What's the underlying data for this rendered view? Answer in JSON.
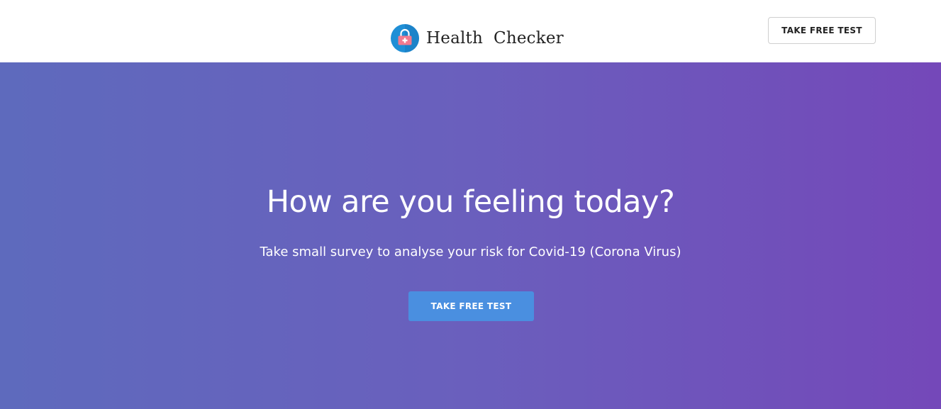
{
  "header": {
    "brand_name": "Health  Checker",
    "brand_icon": "medical-lock-icon",
    "cta_label": "TAKE FREE TEST"
  },
  "hero": {
    "title": "How are you feeling today?",
    "subtitle": "Take small survey to analyse your risk for Covid-19 (Corona Virus)",
    "cta_label": "TAKE FREE TEST"
  },
  "colors": {
    "hero_gradient_start": "#5e6abd",
    "hero_gradient_end": "#7448b9",
    "primary_button": "#4a8fe0",
    "logo_circle": "#1f8fd6",
    "logo_accent": "#f27a8f"
  }
}
